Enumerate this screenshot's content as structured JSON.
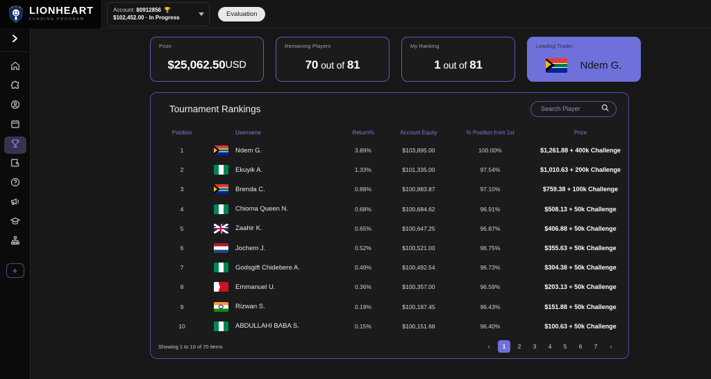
{
  "brand": {
    "title": "LIONHEART",
    "subtitle": "FUNDING PROGRAM"
  },
  "topbar": {
    "account_prefix": "Account:",
    "account_number": "80912856",
    "account_balance_line": "$102,452.00 · In Progress",
    "evaluation_label": "Evaluation"
  },
  "sidebar": {
    "items": [
      {
        "name": "home",
        "label": "Home"
      },
      {
        "name": "puzzle",
        "label": "Challenges"
      },
      {
        "name": "account",
        "label": "Account"
      },
      {
        "name": "calendar",
        "label": "Calendar"
      },
      {
        "name": "trophy",
        "label": "Competitions"
      },
      {
        "name": "payout",
        "label": "Payouts"
      },
      {
        "name": "help",
        "label": "Help"
      },
      {
        "name": "megaphone",
        "label": "Announcements"
      },
      {
        "name": "education",
        "label": "Education"
      },
      {
        "name": "affiliate",
        "label": "Affiliate"
      }
    ],
    "add_label": "+"
  },
  "stats": [
    {
      "label": "Prize",
      "value": "$25,062.50",
      "unit": "USD",
      "type": "money"
    },
    {
      "label": "Remaining Players",
      "value": "70",
      "mid": "out of",
      "value2": "81",
      "type": "ratio"
    },
    {
      "label": "My Ranking",
      "value": "1",
      "mid": "out of",
      "value2": "81",
      "type": "ratio"
    },
    {
      "label": "Leading Trader",
      "value": "Ndem G.",
      "flag": "f-za",
      "type": "leader"
    }
  ],
  "panel": {
    "title": "Tournament Rankings",
    "search_placeholder": "Search Player",
    "columns": [
      "Position",
      "Username",
      "Return%",
      "Account Equity",
      "% Position from 1st",
      "Prize"
    ],
    "rows": [
      {
        "position": "1",
        "flag": "f-za",
        "username": "Ndem G.",
        "return": "3.89%",
        "equity": "$103,895.00",
        "pct": "100.00%",
        "prize": "$1,261.88 + 400k Challenge"
      },
      {
        "position": "2",
        "flag": "f-ng",
        "username": "Ekuyik A.",
        "return": "1.33%",
        "equity": "$101,335.00",
        "pct": "97.54%",
        "prize": "$1,010.63 + 200k Challenge"
      },
      {
        "position": "3",
        "flag": "f-za",
        "username": "Brenda C.",
        "return": "0.88%",
        "equity": "$100,883.87",
        "pct": "97.10%",
        "prize": "$759.38 + 100k Challenge"
      },
      {
        "position": "4",
        "flag": "f-ng",
        "username": "Chioma Queen N.",
        "return": "0.68%",
        "equity": "$100,684.62",
        "pct": "96.91%",
        "prize": "$508.13 + 50k Challenge"
      },
      {
        "position": "5",
        "flag": "f-gb",
        "username": "Zaahir K.",
        "return": "0.65%",
        "equity": "$100,647.25",
        "pct": "96.87%",
        "prize": "$406.88 + 50k Challenge"
      },
      {
        "position": "6",
        "flag": "f-nl",
        "username": "Jochem J.",
        "return": "0.52%",
        "equity": "$100,521.00",
        "pct": "96.75%",
        "prize": "$355.63 + 50k Challenge"
      },
      {
        "position": "7",
        "flag": "f-ng",
        "username": "Godsgift Chidebere A.",
        "return": "0.49%",
        "equity": "$100,492.54",
        "pct": "96.73%",
        "prize": "$304.38 + 50k Challenge"
      },
      {
        "position": "8",
        "flag": "f-bh",
        "username": "Emmanuel U.",
        "return": "0.36%",
        "equity": "$100,357.00",
        "pct": "96.59%",
        "prize": "$203.13 + 50k Challenge"
      },
      {
        "position": "9",
        "flag": "f-in",
        "username": "Rizwan S.",
        "return": "0.19%",
        "equity": "$100,187.45",
        "pct": "96.43%",
        "prize": "$151.88 + 50k Challenge"
      },
      {
        "position": "10",
        "flag": "f-ng",
        "username": "ABDULLAHI BABA S.",
        "return": "0.15%",
        "equity": "$100,151.68",
        "pct": "96.40%",
        "prize": "$100.63 + 50k Challenge"
      }
    ],
    "showing_text": "Showing 1 to 10 of 70 items",
    "pagination": {
      "prev": "‹",
      "next": "›",
      "pages": [
        "1",
        "2",
        "3",
        "4",
        "5",
        "6",
        "7"
      ],
      "active": "1"
    }
  },
  "colors": {
    "accent": "#6f70d9",
    "card_border": "#5a5bc0",
    "background": "#171717",
    "panel": "#1b1b1b",
    "badge_light": "#e8e8e8"
  }
}
